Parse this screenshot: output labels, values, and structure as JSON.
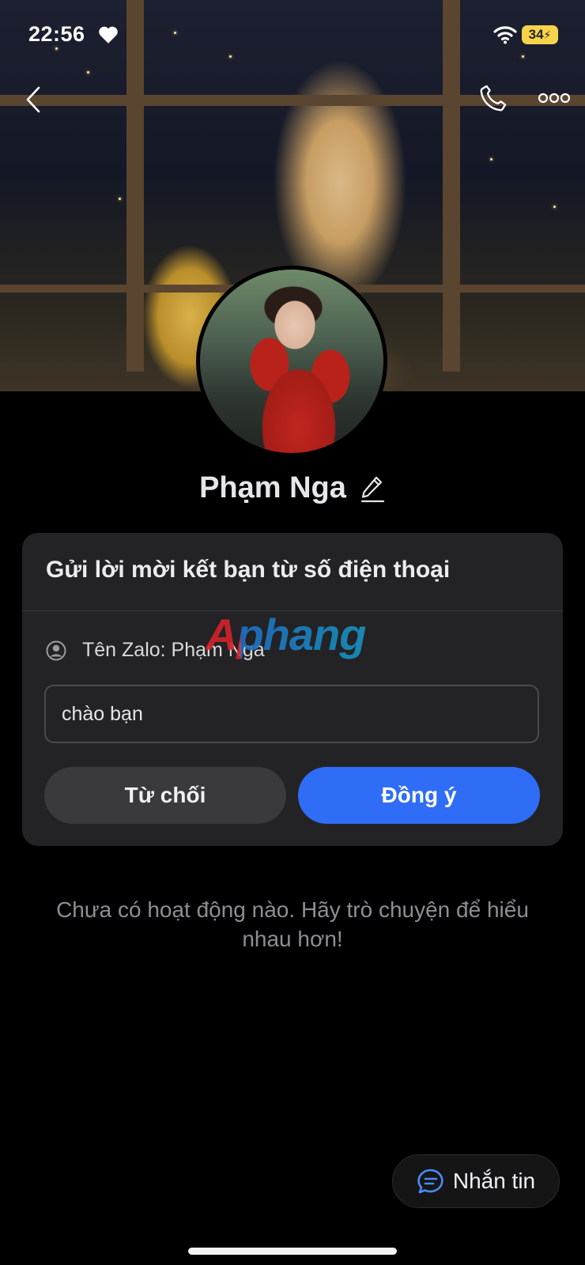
{
  "status_bar": {
    "time": "22:56",
    "battery": "34"
  },
  "profile": {
    "name": "Phạm Nga"
  },
  "request_card": {
    "title": "Gửi lời mời kết bạn từ số điện thoại",
    "zalo_name_label": "Tên Zalo: Phạm Nga",
    "message_value": "chào bạn",
    "decline_label": "Từ chối",
    "accept_label": "Đồng ý"
  },
  "watermark": "Aphang",
  "empty_state": "Chưa có hoạt động nào. Hãy trò chuyện để hiểu nhau hơn!",
  "message_button": {
    "label": "Nhắn tin"
  },
  "colors": {
    "accent": "#2f6df6",
    "card_bg": "#232325",
    "battery": "#f5d34a"
  },
  "icons": [
    "heart-icon",
    "wifi-icon",
    "back-icon",
    "phone-icon",
    "more-icon",
    "edit-icon",
    "user-circle-icon",
    "chat-bubble-icon"
  ]
}
